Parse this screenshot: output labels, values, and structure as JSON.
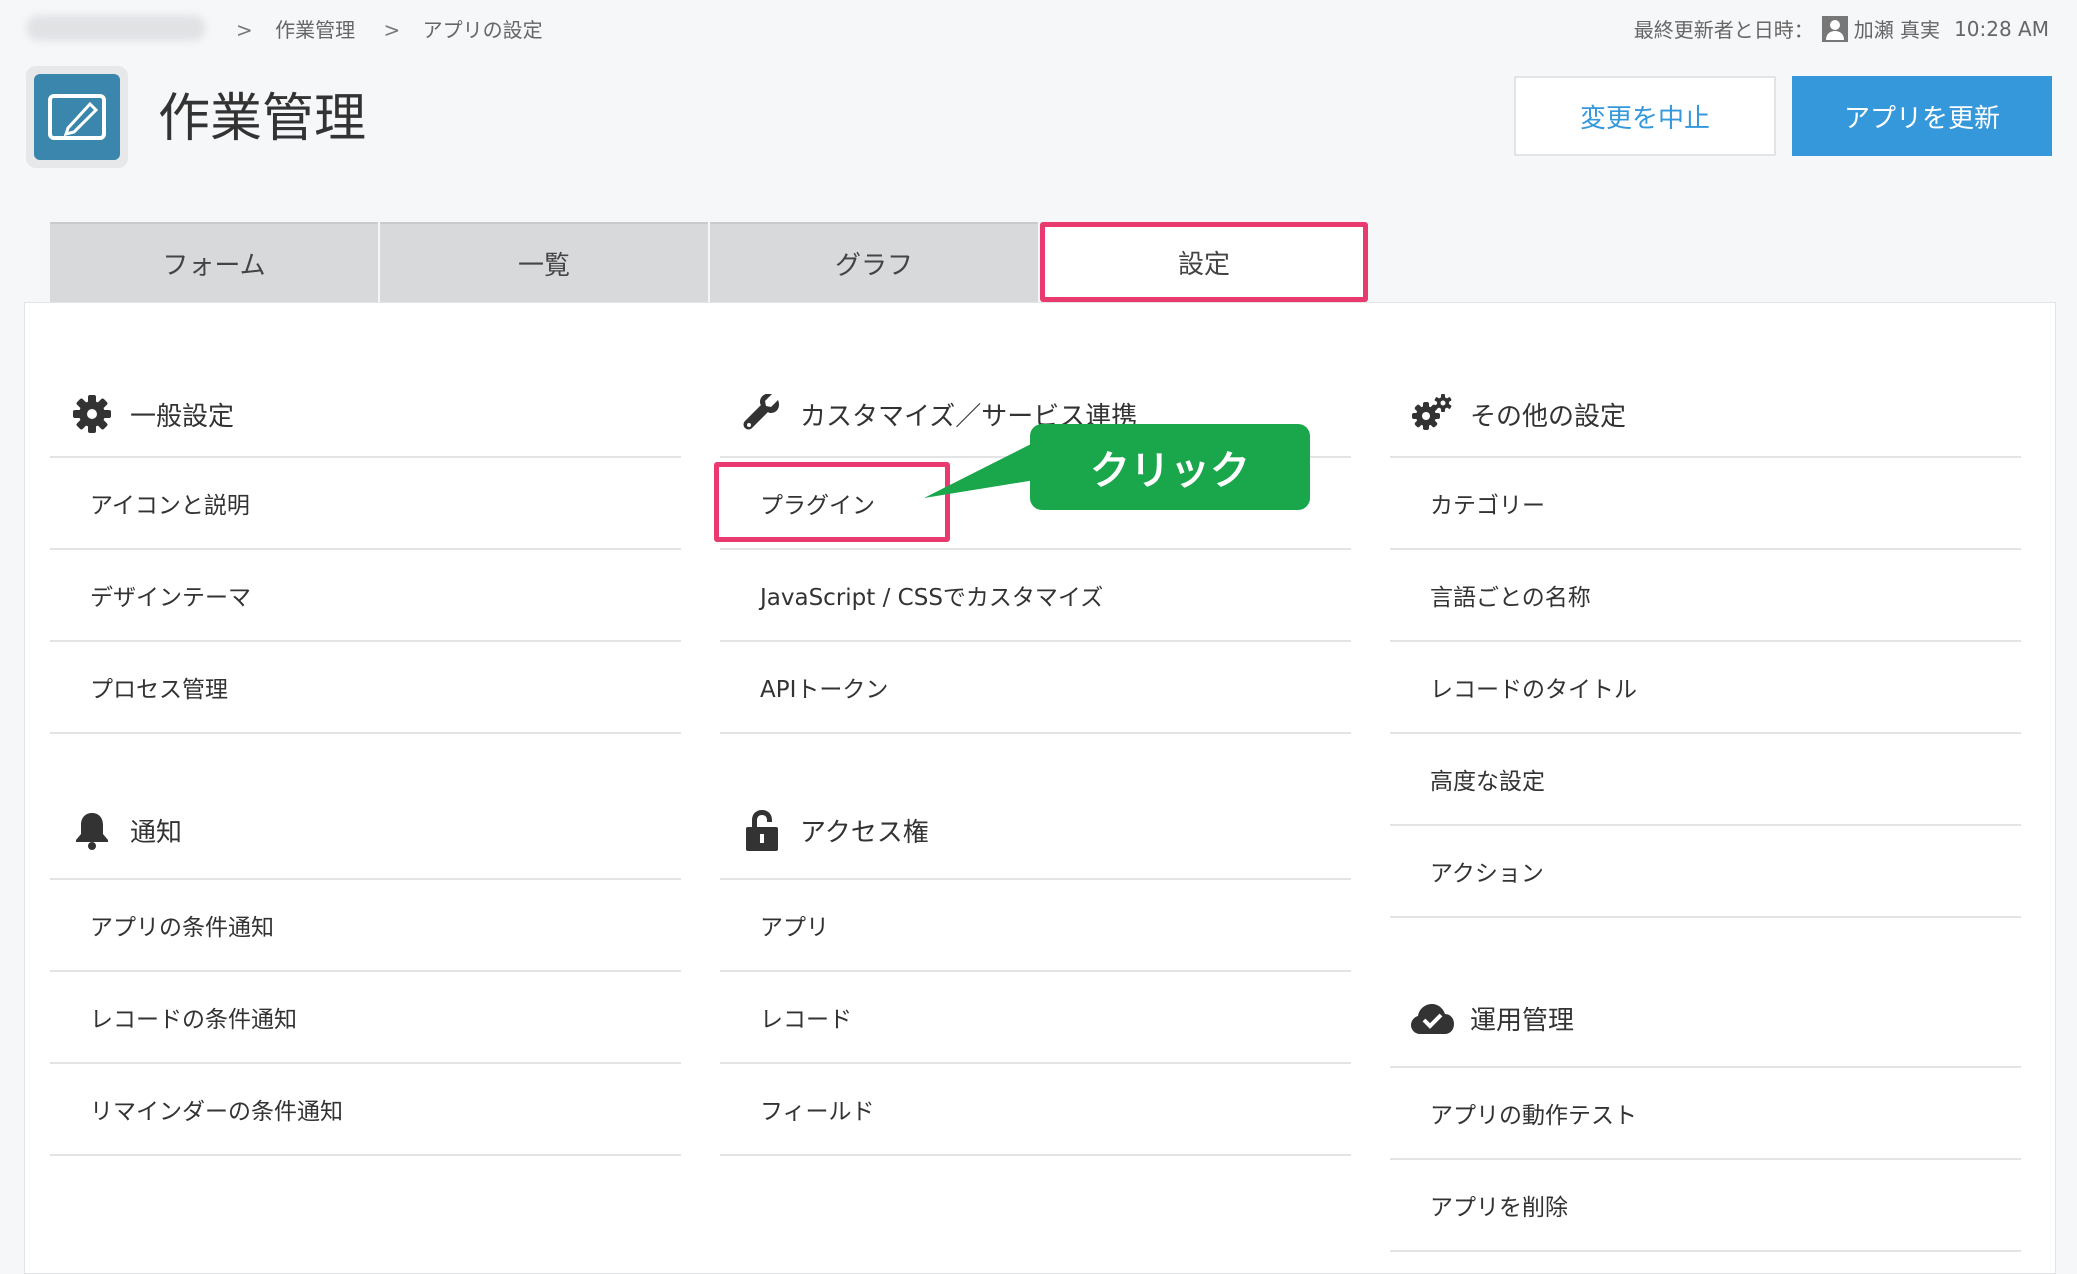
{
  "breadcrumb": {
    "items": [
      "作業管理",
      "アプリの設定"
    ],
    "separator": ">"
  },
  "meta": {
    "label": "最終更新者と日時：",
    "user": "加瀬 真実",
    "time": "10:28 AM"
  },
  "header": {
    "title": "作業管理",
    "cancel_label": "変更を中止",
    "update_label": "アプリを更新"
  },
  "tabs": [
    {
      "label": "フォーム"
    },
    {
      "label": "一覧"
    },
    {
      "label": "グラフ"
    },
    {
      "label": "設定"
    }
  ],
  "sections": {
    "general": {
      "title": "一般設定",
      "icon": "gear-icon",
      "items": [
        "アイコンと説明",
        "デザインテーマ",
        "プロセス管理"
      ]
    },
    "notify": {
      "title": "通知",
      "icon": "bell-icon",
      "items": [
        "アプリの条件通知",
        "レコードの条件通知",
        "リマインダーの条件通知"
      ]
    },
    "custom": {
      "title": "カスタマイズ／サービス連携",
      "icon": "wrench-icon",
      "items": [
        "プラグイン",
        "JavaScript / CSSでカスタマイズ",
        "APIトークン"
      ]
    },
    "access": {
      "title": "アクセス権",
      "icon": "lock-icon",
      "items": [
        "アプリ",
        "レコード",
        "フィールド"
      ]
    },
    "other": {
      "title": "その他の設定",
      "icon": "gears-icon",
      "items": [
        "カテゴリー",
        "言語ごとの名称",
        "レコードのタイトル",
        "高度な設定",
        "アクション"
      ]
    },
    "ops": {
      "title": "運用管理",
      "icon": "cloud-check-icon",
      "items": [
        "アプリの動作テスト",
        "アプリを削除"
      ]
    }
  },
  "annotation": {
    "label": "クリック"
  },
  "colors": {
    "accent": "#3498db",
    "highlight": "#e83a6f",
    "callout": "#1aa64a",
    "app_icon": "#3a86ad"
  }
}
